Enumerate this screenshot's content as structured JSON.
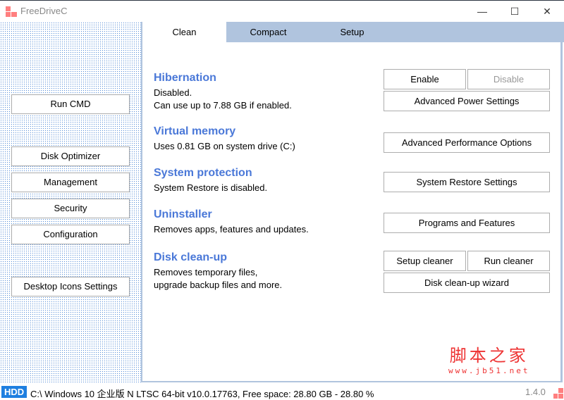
{
  "window": {
    "title": "FreeDriveC",
    "minimize": "—",
    "maximize": "☐",
    "close": "✕"
  },
  "sidebar": {
    "items": [
      {
        "label": "Run CMD"
      },
      {
        "label": "Disk Optimizer"
      },
      {
        "label": "Management"
      },
      {
        "label": "Security"
      },
      {
        "label": "Configuration"
      },
      {
        "label": "Desktop Icons Settings"
      }
    ]
  },
  "tabs": [
    {
      "label": "Clean"
    },
    {
      "label": "Compact"
    },
    {
      "label": "Setup"
    }
  ],
  "sections": {
    "hibernation": {
      "title": "Hibernation",
      "line1": "Disabled.",
      "line2": "Can use up to 7.88 GB if enabled.",
      "enable": "Enable",
      "disable": "Disable",
      "power": "Advanced Power Settings"
    },
    "virtual": {
      "title": "Virtual memory",
      "line1": "Uses 0.81 GB on system drive (C:)",
      "perf": "Advanced Performance Options"
    },
    "protection": {
      "title": "System protection",
      "line1": "System Restore is disabled.",
      "restore": "System Restore Settings"
    },
    "uninstaller": {
      "title": "Uninstaller",
      "line1": "Removes apps, features and updates.",
      "programs": "Programs and Features"
    },
    "cleanup": {
      "title": "Disk clean-up",
      "line1": "Removes temporary files,",
      "line2": "upgrade backup files and more.",
      "setup": "Setup cleaner",
      "run": "Run cleaner",
      "wizard": "Disk clean-up wizard"
    }
  },
  "watermark": {
    "cn": "脚本之家",
    "url": "www.jb51.net"
  },
  "status": {
    "badge": "HDD",
    "text": "C:\\ Windows 10 企业版 N LTSC 64-bit v10.0.17763, Free space: 28.80 GB - 28.80 %",
    "version": "1.4.0"
  }
}
